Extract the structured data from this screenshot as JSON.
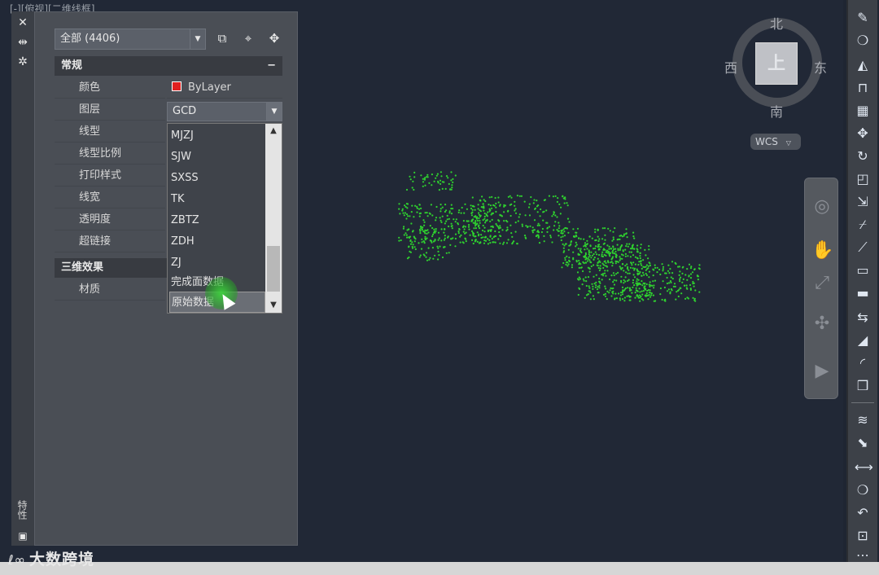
{
  "viewport": {
    "label": "[-][俯视][二维线框]"
  },
  "palette": {
    "vertical_title": "特性",
    "selection": "全部 (4406)",
    "general_header": "常规",
    "general_toggle": "−",
    "props": [
      {
        "name": "颜色",
        "value": "ByLayer"
      },
      {
        "name": "图层",
        "value": "GCD"
      },
      {
        "name": "线型",
        "value": ""
      },
      {
        "name": "线型比例",
        "value": ""
      },
      {
        "name": "打印样式",
        "value": ""
      },
      {
        "name": "线宽",
        "value": ""
      },
      {
        "name": "透明度",
        "value": ""
      },
      {
        "name": "超链接",
        "value": ""
      }
    ],
    "three_d_header": "三维效果",
    "material_label": "材质"
  },
  "layer_dropdown": {
    "items": [
      "MJZJ",
      "SJW",
      "SXSS",
      "TK",
      "ZBTZ",
      "ZDH",
      "ZJ",
      "完成面数据",
      "原始数据"
    ],
    "highlighted": "原始数据"
  },
  "viewcube": {
    "north": "北",
    "south": "南",
    "east": "东",
    "west": "西",
    "face": "上",
    "wcs": "WCS"
  },
  "watermark": {
    "logo": "ℓ∞",
    "text": "大数跨境"
  },
  "colors": {
    "points": "#2fd12f",
    "background": "#212836",
    "layer_swatch": "#e02020"
  }
}
